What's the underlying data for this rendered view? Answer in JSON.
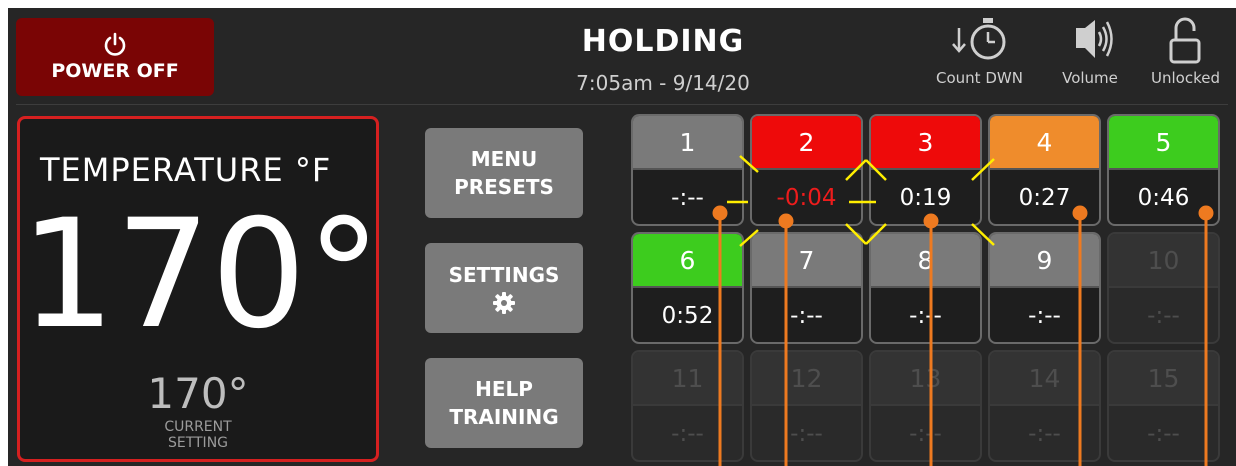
{
  "power": {
    "label": "POWER OFF",
    "icon": "power-icon"
  },
  "header": {
    "status": "HOLDING",
    "datetime": "7:05am - 9/14/20"
  },
  "header_icons": {
    "countdown": {
      "label": "Count DWN",
      "icon": "stopwatch-icon"
    },
    "volume": {
      "label": "Volume",
      "icon": "speaker-icon"
    },
    "lock": {
      "label": "Unlocked",
      "icon": "unlocked-padlock-icon"
    }
  },
  "temperature": {
    "title": "TEMPERATURE °F",
    "value": "170°",
    "setting_value": "170°",
    "setting_line1": "CURRENT",
    "setting_line2": "SETTING"
  },
  "menu": {
    "presets_line1": "MENU",
    "presets_line2": "PRESETS",
    "settings_label": "SETTINGS",
    "help_line1": "HELP",
    "help_line2": "TRAINING"
  },
  "colors": {
    "power_bg": "#7a0505",
    "alert_red": "#ee0a0a",
    "warning_orange": "#ef8c2c",
    "ok_green": "#3dcc1e",
    "idle_gray": "#7a7a7a",
    "callout_orange": "#ee7a20",
    "flash_yellow": "#ffee00"
  },
  "tiles": [
    {
      "num": "1",
      "time": "-:--",
      "state": "idle"
    },
    {
      "num": "2",
      "time": "-0:04",
      "state": "expired"
    },
    {
      "num": "3",
      "time": "0:19",
      "state": "alert"
    },
    {
      "num": "4",
      "time": "0:27",
      "state": "warning"
    },
    {
      "num": "5",
      "time": "0:46",
      "state": "ok"
    },
    {
      "num": "6",
      "time": "0:52",
      "state": "ok"
    },
    {
      "num": "7",
      "time": "-:--",
      "state": "idle"
    },
    {
      "num": "8",
      "time": "-:--",
      "state": "idle"
    },
    {
      "num": "9",
      "time": "-:--",
      "state": "idle"
    },
    {
      "num": "10",
      "time": "-:--",
      "state": "disabled"
    },
    {
      "num": "11",
      "time": "-:--",
      "state": "disabled"
    },
    {
      "num": "12",
      "time": "-:--",
      "state": "disabled"
    },
    {
      "num": "13",
      "time": "-:--",
      "state": "disabled"
    },
    {
      "num": "14",
      "time": "-:--",
      "state": "disabled"
    },
    {
      "num": "15",
      "time": "-:--",
      "state": "disabled"
    }
  ]
}
